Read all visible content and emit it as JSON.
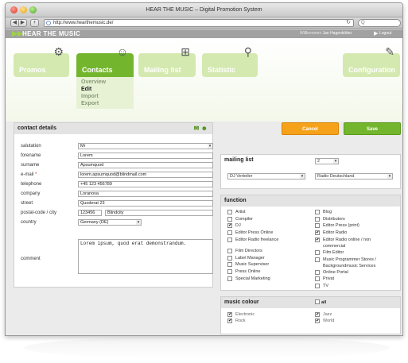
{
  "window": {
    "title": "HEAR THE MUSIC – Digital Promotion System"
  },
  "toolbar": {
    "back": "◀",
    "forward": "▶",
    "add": "+",
    "url": "http://www.hearthemusic.de/",
    "refresh": "↻",
    "search_placeholder": "Q"
  },
  "header": {
    "logo_mark": "▶▶",
    "logo_text": "HEAR THE MUSIC",
    "welcome_label": "Willkommen",
    "user": "Jan Hagenkötter",
    "logout": "Logout"
  },
  "nav": {
    "tabs": [
      {
        "label": "Promos",
        "icon": "gear-icon",
        "active": false
      },
      {
        "label": "Contacts",
        "icon": "person-icon",
        "active": true
      },
      {
        "label": "Mailing list",
        "icon": "sitemap-icon",
        "active": false
      },
      {
        "label": "Statistic",
        "icon": "magnifier-icon",
        "active": false
      },
      {
        "label": "Configuration",
        "icon": "wrench-icon",
        "active": false
      }
    ],
    "subnav": [
      "Overview",
      "Edit",
      "Import",
      "Export"
    ]
  },
  "contact": {
    "title": "contact details",
    "salutation_label": "salutation",
    "salutation_value": "Mr",
    "forename_label": "forename",
    "forename_value": "Lorem",
    "surname_label": "surname",
    "surname_value": "Apsumquod",
    "email_label": "e-mail",
    "email_required": "*",
    "email_value": "lorem.apsumquod@blindmail.com",
    "telephone_label": "telephone",
    "telephone_value": "+45 123 456789",
    "company_label": "company",
    "company_value": "Loranova",
    "street_label": "street",
    "street_value": "Quoderat 23",
    "postal_label": "postal-code / city",
    "postal_value": "123456",
    "city_value": "Blindcity",
    "country_label": "country",
    "country_value": "Germany (DE)",
    "comment_label": "comment",
    "comment_value": "Lorem ipsum, quod erat demonstrandum."
  },
  "actions": {
    "cancel": "Cancel",
    "save": "Save"
  },
  "mailing": {
    "title": "mailing list",
    "count": "2",
    "list1": "DJ Verteiler",
    "list2": "Radio Deutschland"
  },
  "function": {
    "title": "function",
    "left": [
      {
        "label": "Artist",
        "checked": false
      },
      {
        "label": "Compiler",
        "checked": false
      },
      {
        "label": "DJ",
        "checked": true
      },
      {
        "label": "Editor Press Online",
        "checked": false
      },
      {
        "label": "Editor Radio freelance",
        "checked": false
      },
      {
        "label": "Film Directors",
        "checked": false
      },
      {
        "label": "Label Manager",
        "checked": false
      },
      {
        "label": "Music Supervisor",
        "checked": false
      },
      {
        "label": "Press Online",
        "checked": false
      },
      {
        "label": "Special Marketing",
        "checked": false
      }
    ],
    "right": [
      {
        "label": "Blog",
        "checked": false
      },
      {
        "label": "Distributors",
        "checked": false
      },
      {
        "label": "Editor Press (print)",
        "checked": false
      },
      {
        "label": "Editor Radio",
        "checked": true
      },
      {
        "label": "Editor Radio online / non",
        "label2": "commercial",
        "checked": true
      },
      {
        "label": "Film Editor",
        "checked": false
      },
      {
        "label": "Music Programmer Stores /",
        "label2": "Backgroundmusic Services",
        "checked": false
      },
      {
        "label": "Online Portal",
        "checked": false
      },
      {
        "label": "Privat",
        "checked": false
      },
      {
        "label": "TV",
        "checked": false
      }
    ]
  },
  "music": {
    "title": "music colour",
    "all_label": "all",
    "items": [
      {
        "label": "Electronic",
        "checked": true
      },
      {
        "label": "Rock",
        "checked": true
      },
      {
        "label": "Jazz",
        "checked": true
      },
      {
        "label": "World",
        "checked": true
      }
    ]
  }
}
